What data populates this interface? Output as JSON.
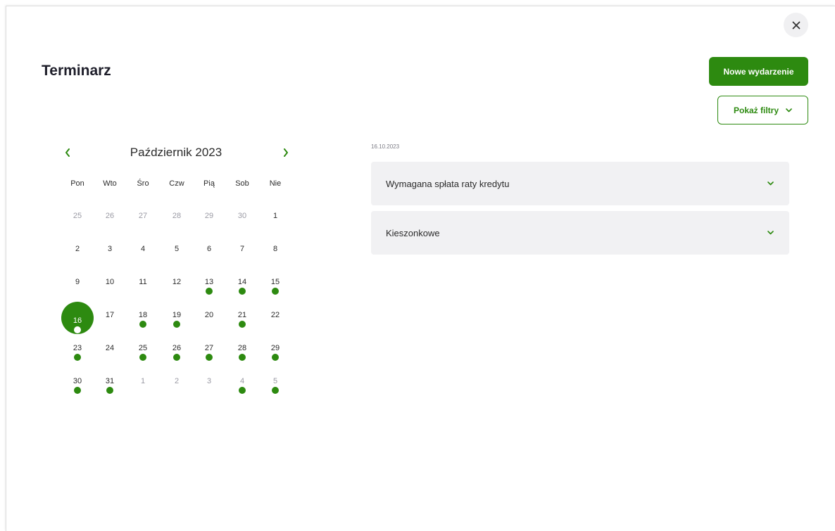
{
  "header": {
    "title": "Terminarz",
    "close_icon": "close-icon"
  },
  "toolbar": {
    "new_event_label": "Nowe wydarzenie",
    "filters_label": "Pokaż filtry"
  },
  "colors": {
    "accent": "#2d8a10",
    "event_bg": "#f1f1f3"
  },
  "calendar": {
    "month_label": "Październik 2023",
    "weekdays": [
      "Pon",
      "Wto",
      "Śro",
      "Czw",
      "Pią",
      "Sob",
      "Nie"
    ],
    "weeks": [
      [
        {
          "d": "25",
          "m": true
        },
        {
          "d": "26",
          "m": true
        },
        {
          "d": "27",
          "m": true
        },
        {
          "d": "28",
          "m": true
        },
        {
          "d": "29",
          "m": true
        },
        {
          "d": "30",
          "m": true
        },
        {
          "d": "1"
        }
      ],
      [
        {
          "d": "2"
        },
        {
          "d": "3"
        },
        {
          "d": "4"
        },
        {
          "d": "5"
        },
        {
          "d": "6"
        },
        {
          "d": "7"
        },
        {
          "d": "8"
        }
      ],
      [
        {
          "d": "9"
        },
        {
          "d": "10"
        },
        {
          "d": "11"
        },
        {
          "d": "12"
        },
        {
          "d": "13",
          "e": true
        },
        {
          "d": "14",
          "e": true
        },
        {
          "d": "15",
          "e": true
        }
      ],
      [
        {
          "d": "16",
          "e": true,
          "s": true
        },
        {
          "d": "17"
        },
        {
          "d": "18",
          "e": true
        },
        {
          "d": "19",
          "e": true
        },
        {
          "d": "20"
        },
        {
          "d": "21",
          "e": true
        },
        {
          "d": "22"
        }
      ],
      [
        {
          "d": "23",
          "e": true
        },
        {
          "d": "24"
        },
        {
          "d": "25",
          "e": true
        },
        {
          "d": "26",
          "e": true
        },
        {
          "d": "27",
          "e": true
        },
        {
          "d": "28",
          "e": true
        },
        {
          "d": "29",
          "e": true
        }
      ],
      [
        {
          "d": "30",
          "e": true
        },
        {
          "d": "31",
          "e": true
        },
        {
          "d": "1",
          "m": true
        },
        {
          "d": "2",
          "m": true
        },
        {
          "d": "3",
          "m": true
        },
        {
          "d": "4",
          "m": true,
          "e": true
        },
        {
          "d": "5",
          "m": true,
          "e": true
        }
      ]
    ]
  },
  "events": {
    "date": "16.10.2023",
    "items": [
      {
        "title": "Wymagana spłata raty kredytu"
      },
      {
        "title": "Kieszonkowe"
      }
    ]
  }
}
